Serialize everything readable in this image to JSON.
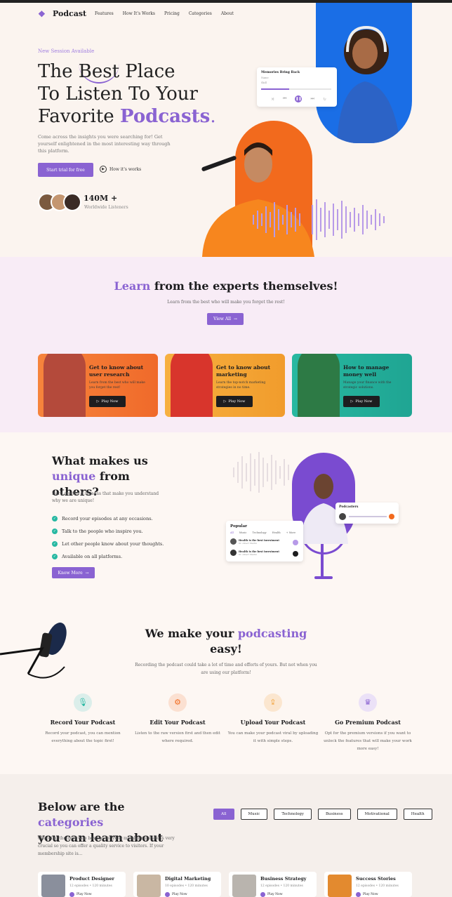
{
  "colors": {
    "accent": "#8a63d2",
    "orange": "#f26a1d",
    "yellow": "#f19c2c",
    "teal": "#1fa593",
    "blue": "#1a6ee6"
  },
  "header": {
    "logo": "Podcast",
    "logo_icon": "waveform-icon",
    "nav": [
      "Features",
      "How It's Works",
      "Pricing",
      "Categories",
      "About"
    ]
  },
  "hero": {
    "kicker": "New Session Available",
    "title_l1_pre": "The ",
    "title_l1_hl": "Best",
    "title_l1_post": " Place",
    "title_l2": "To Listen To Your",
    "title_l3_pre": "Favorite ",
    "title_l3_hl": "Podcasts",
    "subtitle": "Come across the insights you were searching for! Get yourself enlightened in the most interesting way through this platform.",
    "cta": "Start trial for free",
    "how": "How it's works",
    "listeners_count": "140M +",
    "listeners_label": "Worldwide Listeners",
    "player": {
      "title": "Memories Bring Back",
      "artist": "Name",
      "meta": "Skill",
      "progress": 0.4
    }
  },
  "learn": {
    "title_hl": "Learn",
    "title_rest": " from the experts themselves!",
    "subtitle": "Learn from the best who will make you forget the rest!",
    "view_all": "View All",
    "cards": [
      {
        "title": "Get to know about user research",
        "desc": "Learn from the best who will make you forget the rest!",
        "btn": "Play Now"
      },
      {
        "title": "Get to know about marketing",
        "desc": "Learn the top-notch marketing strategies in no time.",
        "btn": "Play Now"
      },
      {
        "title": "How to manage money well",
        "desc": "Manage your finance with the strategic solutions.",
        "btn": "Play Now"
      }
    ]
  },
  "unique": {
    "title_l1": "What makes us",
    "title_hl": "unique",
    "title_rest": " from others?",
    "subtitle": "Here are the 4 reasons that make you understand why we are unique!",
    "items": [
      "Record your episodes at any occasions.",
      "Talk to the people who inspire you.",
      "Let other people know about your thoughts.",
      "Available on all platforms."
    ],
    "btn": "Know More",
    "popular": {
      "title": "Popular",
      "tabs": [
        "All",
        "Music",
        "Technology",
        "Health",
        "+ More"
      ],
      "rows": [
        "Health is the best investment",
        "Health is the best investment"
      ],
      "sub": "Dr. Albert Martin"
    },
    "podcasters": "Podcasters"
  },
  "easy": {
    "title_pre": "We make your ",
    "title_hl": "podcasting",
    "title_post": "easy!",
    "subtitle": "Recording the podcast could take a lot of time and efforts of yours. But not when you are using our platform!",
    "features": [
      {
        "icon": "microphone-icon",
        "title": "Record Your Podcast",
        "desc": "Record your podcast, you can mention everything about the topic first!"
      },
      {
        "icon": "settings-icon",
        "title": "Edit Your Podcast",
        "desc": "Listen to the raw version first and then edit where required."
      },
      {
        "icon": "upload-icon",
        "title": "Upload Your Podcast",
        "desc": "You can make your podcast viral by uploading it with simple steps."
      },
      {
        "icon": "crown-icon",
        "title": "Go Premium Podcast",
        "desc": "Opt for the premium versions if you want to unlock the features that will make your work more easy!"
      }
    ]
  },
  "categories": {
    "title_pre": "Below are the ",
    "title_hl": "categories",
    "title_l2": "you can learn about",
    "subtitle": "Choosing the best web hosting for your membership site is very crucial so you can offer a quality service to visitors. If your membership site is...",
    "pills": [
      "All",
      "Music",
      "Technology",
      "Business",
      "Motivational",
      "Health"
    ],
    "cards": [
      {
        "title": "Product Designer",
        "meta": "12 episodes  •  120 minutes",
        "btn": "Play Now"
      },
      {
        "title": "Digital Marketing",
        "meta": "10 episodes  •  120 minutes",
        "btn": "Play Now"
      },
      {
        "title": "Business Strategy",
        "meta": "12 episodes  •  120 minutes",
        "btn": "Play Now"
      },
      {
        "title": "Success Stories",
        "meta": "12 episodes  •  120 minutes",
        "btn": "Play Now"
      }
    ]
  }
}
